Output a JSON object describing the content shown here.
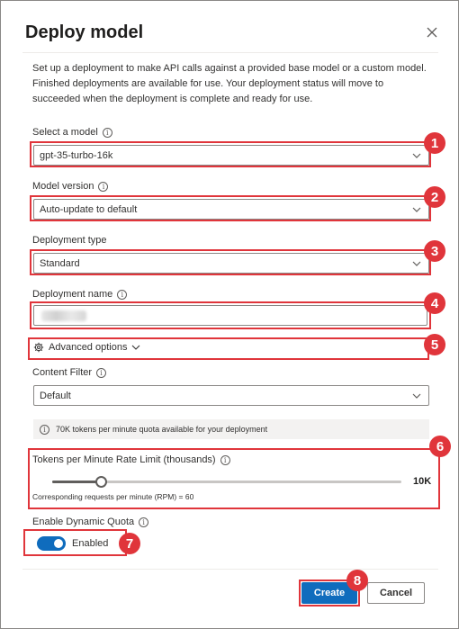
{
  "dialog": {
    "title": "Deploy model",
    "description": "Set up a deployment to make API calls against a provided base model or a custom model. Finished deployments are available for use. Your deployment status will move to succeeded when the deployment is complete and ready for use."
  },
  "fields": {
    "model": {
      "label": "Select a model",
      "value": "gpt-35-turbo-16k"
    },
    "version": {
      "label": "Model version",
      "value": "Auto-update to default"
    },
    "type": {
      "label": "Deployment type",
      "value": "Standard"
    },
    "name": {
      "label": "Deployment name",
      "value": ""
    },
    "advanced": {
      "label": "Advanced options"
    },
    "content_filter": {
      "label": "Content Filter",
      "value": "Default"
    },
    "quota_note": "70K tokens per minute quota available for your deployment",
    "rate_limit": {
      "label": "Tokens per Minute Rate Limit (thousands)",
      "value": "10K",
      "fraction": 0.14,
      "rpm": "Corresponding requests per minute (RPM) = 60"
    },
    "dynamic_quota": {
      "label": "Enable Dynamic Quota",
      "state": "Enabled"
    }
  },
  "buttons": {
    "create": "Create",
    "cancel": "Cancel"
  },
  "annotations": [
    "1",
    "2",
    "3",
    "4",
    "5",
    "6",
    "7",
    "8"
  ],
  "colors": {
    "accent": "#0f6cbd",
    "annotation": "#e0353b"
  },
  "icons": [
    "close-icon",
    "info-icon",
    "chevron-down-icon",
    "gear-icon"
  ]
}
